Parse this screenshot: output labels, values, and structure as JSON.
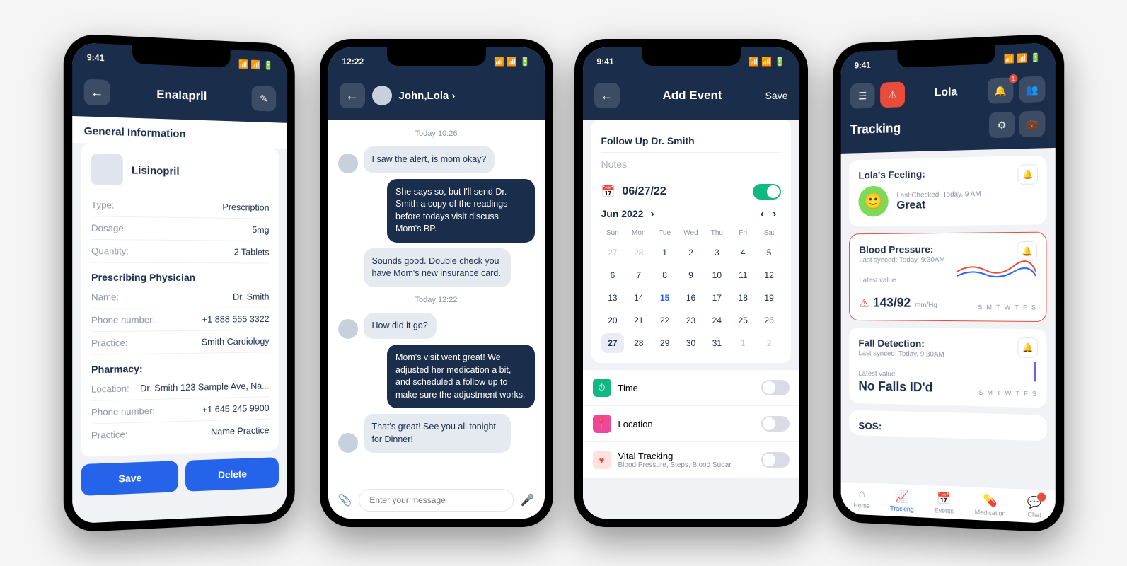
{
  "status_time": {
    "p1": "9:41",
    "p2": "12:22",
    "p3": "9:41",
    "p4": "9:41"
  },
  "phone1": {
    "title": "Enalapril",
    "section": "General Information",
    "med_name": "Lisinopril",
    "rows": {
      "type_label": "Type:",
      "type_value": "Prescription",
      "dosage_label": "Dosage:",
      "dosage_value": "5mg",
      "qty_label": "Quantity:",
      "qty_value": "2 Tablets"
    },
    "physician_title": "Prescribing Physician",
    "physician": {
      "name_label": "Name:",
      "name_value": "Dr. Smith",
      "phone_label": "Phone number:",
      "phone_value": "+1 888 555 3322",
      "practice_label": "Practice:",
      "practice_value": "Smith Cardiology"
    },
    "pharmacy_title": "Pharmacy:",
    "pharmacy": {
      "loc_label": "Location:",
      "loc_value": "Dr. Smith 123 Sample Ave, Na...",
      "phone_label": "Phone number:",
      "phone_value": "+1 645 245 9900",
      "practice_label": "Practice:",
      "practice_value": "Name Practice"
    },
    "save_btn": "Save",
    "delete_btn": "Delete"
  },
  "phone2": {
    "title": "John,Lola",
    "ts1": "Today 10:26",
    "msg1": "I saw the alert, is mom okay?",
    "msg2": "She says so, but I'll send Dr. Smith a copy of the readings before todays visit discuss Mom's BP.",
    "msg3": "Sounds good.  Double check you have Mom's new insurance card.",
    "ts2": "Today 12:22",
    "msg4": "How did it go?",
    "msg5": "Mom's visit went great! We adjusted her medication a bit, and scheduled a follow up to make sure the adjustment works.",
    "msg6": "That's great! See you all tonight for Dinner!",
    "placeholder": "Enter your message"
  },
  "phone3": {
    "title": "Add Event",
    "save": "Save",
    "event_name": "Follow Up Dr. Smith",
    "notes_placeholder": "Notes",
    "date": "06/27/22",
    "month": "Jun 2022",
    "dow": [
      "Sun",
      "Mon",
      "Tue",
      "Wed",
      "Thu",
      "Fri",
      "Sat"
    ],
    "weeks": [
      [
        "27",
        "28",
        "1",
        "2",
        "3",
        "4",
        "5"
      ],
      [
        "6",
        "7",
        "8",
        "9",
        "10",
        "11",
        "12"
      ],
      [
        "13",
        "14",
        "15",
        "16",
        "17",
        "18",
        "19"
      ],
      [
        "20",
        "21",
        "22",
        "23",
        "24",
        "25",
        "26"
      ],
      [
        "27",
        "28",
        "29",
        "30",
        "31",
        "1",
        "2"
      ]
    ],
    "selected_day": "27",
    "today": "15",
    "opt_time": "Time",
    "opt_location": "Location",
    "opt_vital": "Vital Tracking",
    "opt_vital_sub": "Blood Pressure, Steps, Blood Sugar"
  },
  "phone4": {
    "name": "Lola",
    "badge": "1",
    "tracking": "Tracking",
    "feeling_label": "Lola's Feeling:",
    "feeling_checked": "Last Checked: Today, 9 AM",
    "feeling_value": "Great",
    "bp_label": "Blood Pressure:",
    "bp_synced": "Last synced: Today, 9:30AM",
    "bp_latest_label": "Latest value",
    "bp_value": "143/92",
    "bp_unit": "mm/Hg",
    "fall_label": "Fall Detection:",
    "fall_synced": "Last synced: Today, 9:30AM",
    "fall_latest_label": "Latest value",
    "fall_value": "No Falls ID'd",
    "sos_label": "SOS:",
    "weekdays": [
      "S",
      "M",
      "T",
      "W",
      "T",
      "F",
      "S"
    ],
    "nav": {
      "home": "Home",
      "tracking": "Tracking",
      "events": "Events",
      "medication": "Medication",
      "chat": "Chat"
    }
  }
}
